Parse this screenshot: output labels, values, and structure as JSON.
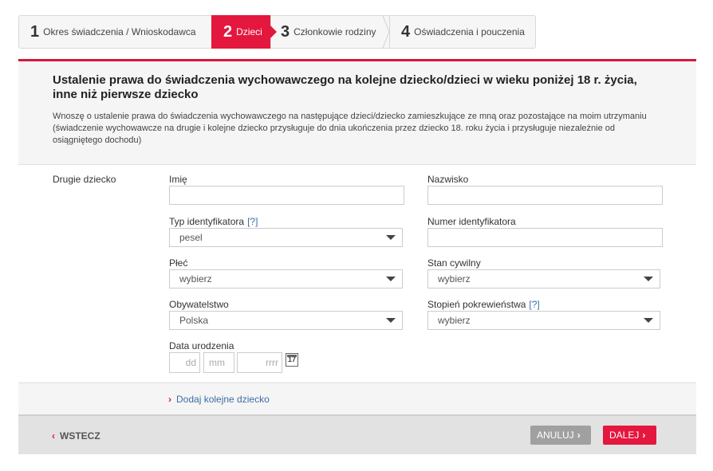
{
  "steps": [
    {
      "num": "1",
      "label": "Okres świadczenia / Wnioskodawca"
    },
    {
      "num": "2",
      "label": "Dzieci"
    },
    {
      "num": "3",
      "label": "Członkowie rodziny"
    },
    {
      "num": "4",
      "label": "Oświadczenia i pouczenia"
    }
  ],
  "header": {
    "title": "Ustalenie prawa do świadczenia wychowawczego na kolejne dziecko/dzieci w wieku poniżej 18 r. życia, inne niż pierwsze dziecko",
    "description": "Wnoszę o ustalenie prawa do świadczenia wychowawczego na następujące dzieci/dziecko zamieszkujące ze mną oraz pozostające na moim utrzymaniu (świadczenie wychowawcze na drugie i kolejne dziecko przysługuje do dnia ukończenia przez dziecko 18. roku życia i przysługuje niezależnie od osiągniętego dochodu)"
  },
  "form": {
    "child_label": "Drugie dziecko",
    "first_name_label": "Imię",
    "first_name_value": "",
    "last_name_label": "Nazwisko",
    "last_name_value": "",
    "id_type_label": "Typ identyfikatora",
    "help": "[?]",
    "id_type_value": "pesel",
    "id_number_label": "Numer identyfikatora",
    "id_number_value": "",
    "sex_label": "Płeć",
    "sex_value": "wybierz",
    "marital_label": "Stan cywilny",
    "marital_value": "wybierz",
    "citizenship_label": "Obywatelstwo",
    "citizenship_value": "Polska",
    "relation_label": "Stopień pokrewieństwa",
    "relation_value": "wybierz",
    "birthdate_label": "Data urodzenia",
    "dd_placeholder": "dd",
    "mm_placeholder": "mm",
    "yyyy_placeholder": "rrrr",
    "calendar_day": "17"
  },
  "add_child": "Dodaj kolejne dziecko",
  "footer": {
    "back": "WSTECZ",
    "cancel": "ANULUJ",
    "next": "DALEJ"
  },
  "colors": {
    "accent": "#e4173e",
    "link": "#3a6ea5"
  }
}
